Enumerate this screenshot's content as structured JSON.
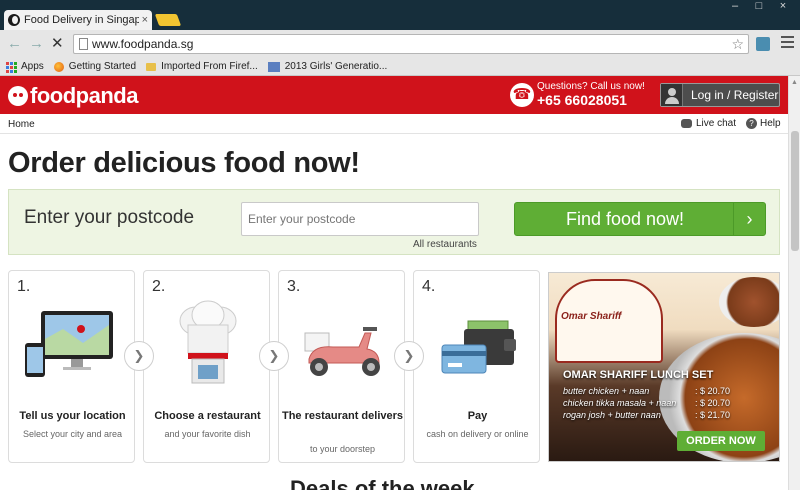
{
  "browser": {
    "tab_title": "Food Delivery in Singapore",
    "tab_close": "×",
    "url": "www.foodpanda.sg",
    "window_buttons": [
      "–",
      "□",
      "×"
    ],
    "bookmarks": [
      "Apps",
      "Getting Started",
      "Imported From Firef...",
      "2013 Girls' Generatio..."
    ]
  },
  "header": {
    "logo_text": "foodpanda",
    "call_question": "Questions? Call us now!",
    "call_number": "+65 66028051",
    "login_label": "Log in / Register"
  },
  "subnav": {
    "home": "Home",
    "live_chat": "Live chat",
    "help": "Help"
  },
  "main": {
    "headline": "Order delicious food now!",
    "postcode_label": "Enter your postcode",
    "postcode_placeholder": "Enter your postcode",
    "all_restaurants": "All restaurants",
    "find_button": "Find food now!",
    "find_arrow": "›"
  },
  "steps": [
    {
      "num": "1.",
      "title": "Tell us your location",
      "subtitle": "Select your city and area"
    },
    {
      "num": "2.",
      "title": "Choose a restaurant",
      "subtitle": "and your favorite dish"
    },
    {
      "num": "3.",
      "title": "The restaurant delivers",
      "subtitle": "to your doorstep"
    },
    {
      "num": "4.",
      "title": "Pay",
      "subtitle": "cash on delivery or online"
    }
  ],
  "promo": {
    "brand": "Omar Shariff",
    "title": "OMAR SHARIFF LUNCH SET",
    "items": [
      {
        "name": "butter chicken + naan",
        "price": ": $ 20.70"
      },
      {
        "name": "chicken tikka masala + naan",
        "price": ": $ 20.70"
      },
      {
        "name": "rogan josh + butter naan",
        "price": ": $ 21.70"
      }
    ],
    "order_button": "ORDER NOW"
  },
  "cutoff_heading": "Deals of the week",
  "colors": {
    "brand_red": "#d0121b",
    "cta_green": "#5fae35"
  }
}
